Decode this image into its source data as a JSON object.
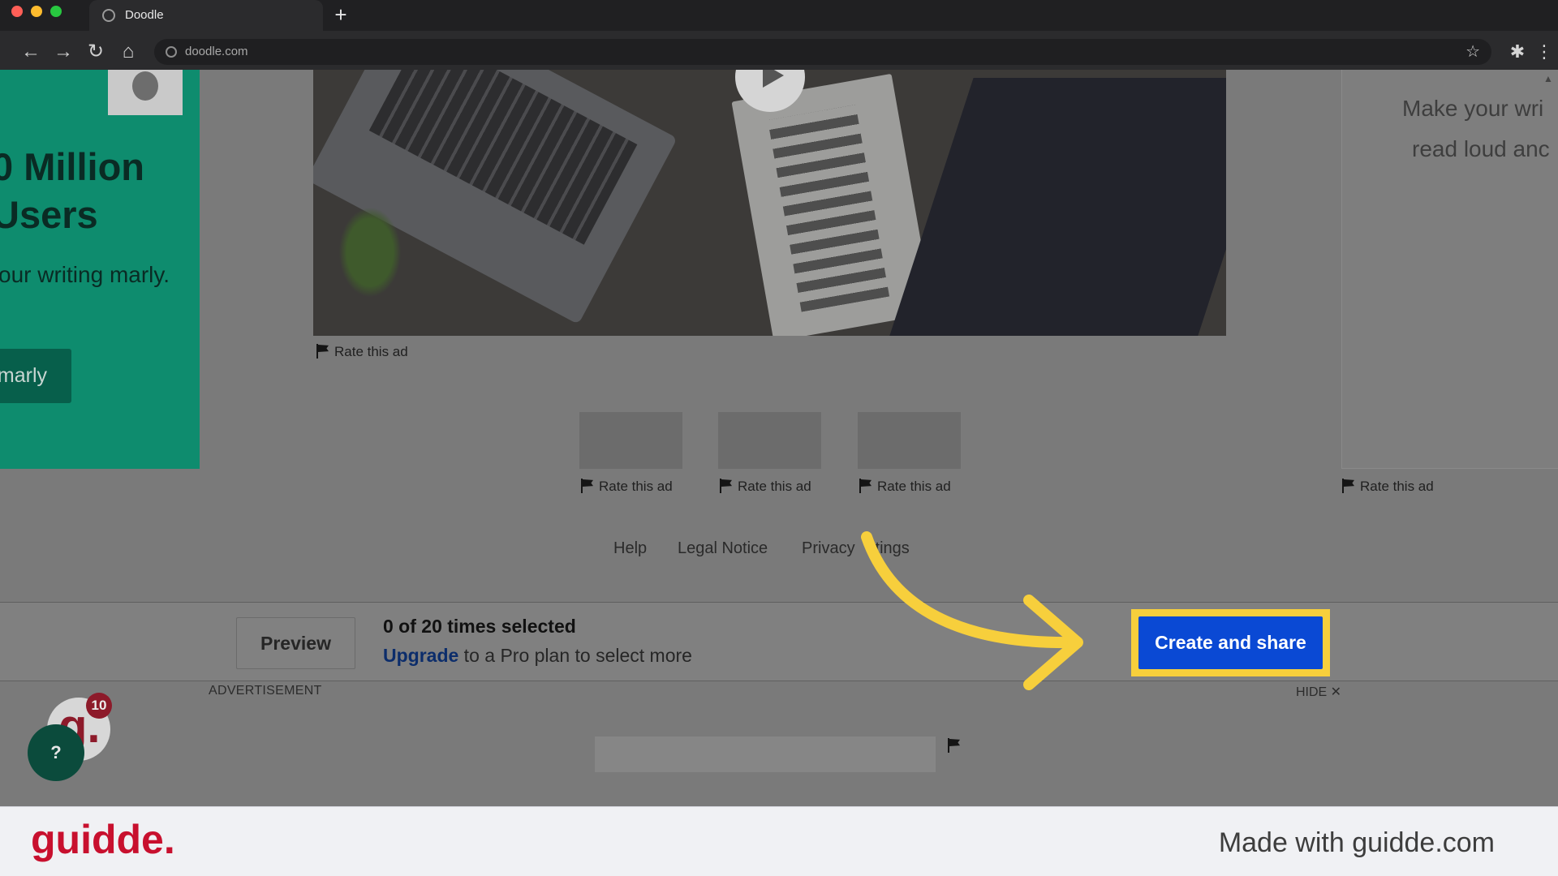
{
  "browser": {
    "tab_title": "Doodle",
    "new_tab_label": "+",
    "url": "doodle.com"
  },
  "ads": {
    "green": {
      "headline": "0 Million Users",
      "body": "our writing marly.",
      "cta": "marly"
    },
    "right": {
      "line1": "Make your wri",
      "line2": "read loud anc"
    },
    "rate_label": "Rate this ad"
  },
  "footer_links": [
    "Help",
    "Legal Notice",
    "Privacy",
    "ttings"
  ],
  "bottom_bar": {
    "preview_label": "Preview",
    "selection_count": "0 of 20 times selected",
    "upgrade_link": "Upgrade",
    "upgrade_rest": " to a Pro plan to select more",
    "create_share_label": "Create and share"
  },
  "advertisement": {
    "label": "ADVERTISEMENT",
    "hide_label": "HIDE ✕"
  },
  "guidde_widget": {
    "badge_letter": "g.",
    "count": "10",
    "help": "?"
  },
  "guidde": {
    "logo": "guidde.",
    "made_with": "Made with guidde.com"
  },
  "colors": {
    "highlight": "#f7cf3c",
    "primary_button": "#0a49d4",
    "guidde_red": "#c8102e"
  }
}
